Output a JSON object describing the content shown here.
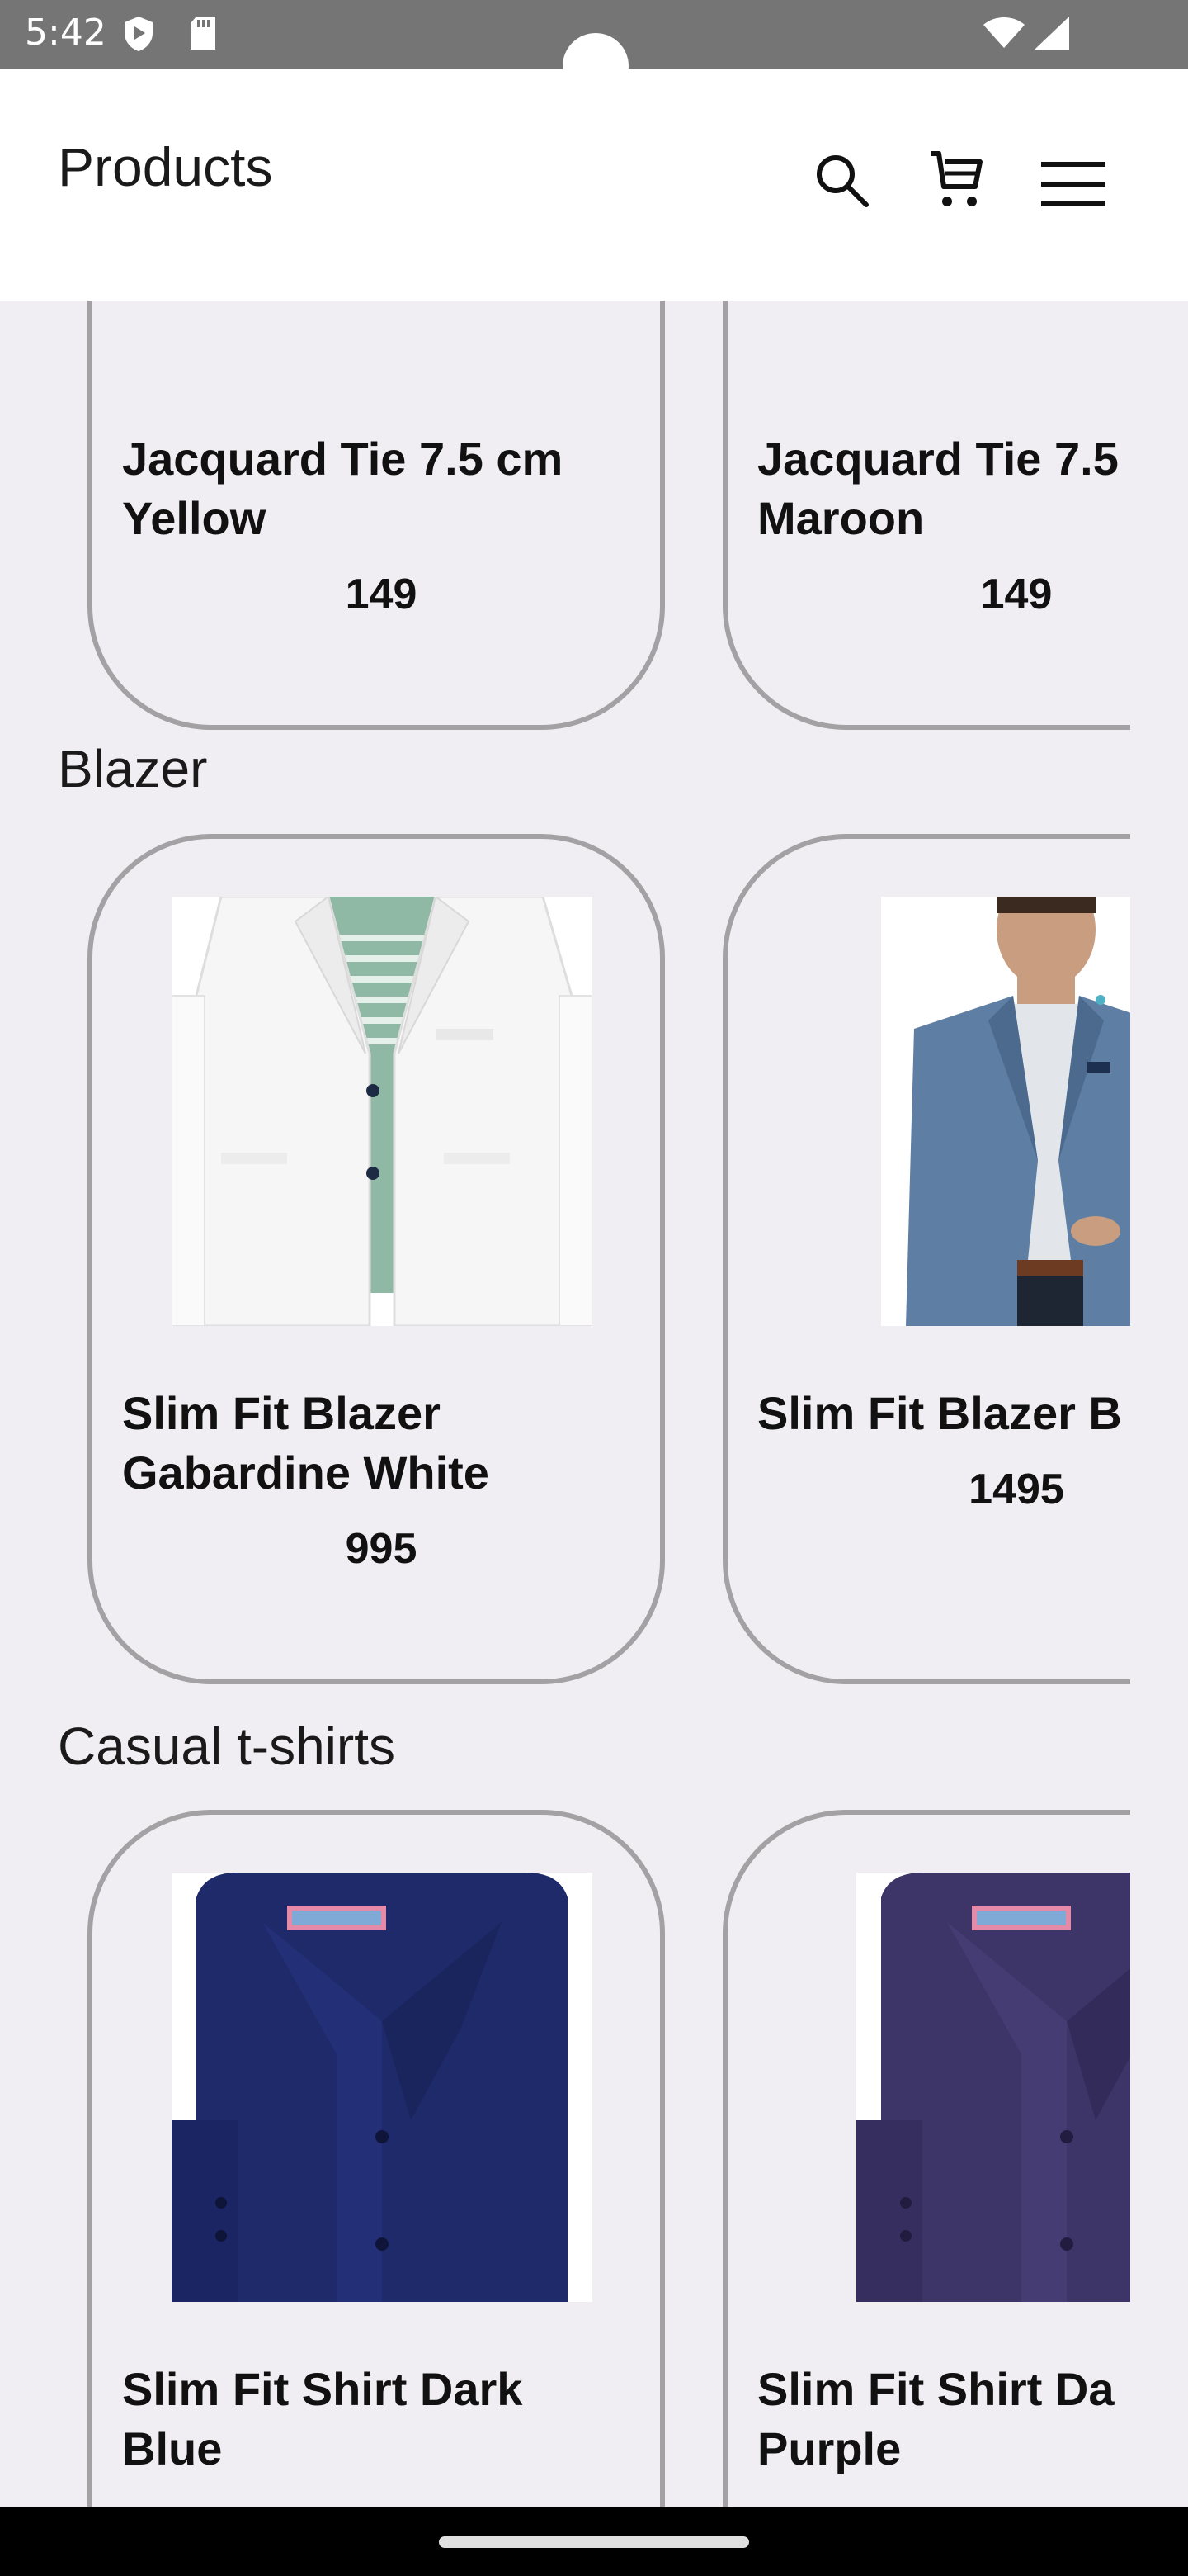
{
  "status_bar": {
    "time": "5:42"
  },
  "app_bar": {
    "title": "Products",
    "icons": [
      "search-icon",
      "cart-icon",
      "menu-icon"
    ]
  },
  "sections": [
    {
      "title": "",
      "cards": [
        {
          "name_line1": "Jacquard Tie 7.5 cm",
          "name_line2": "Yellow",
          "price": "149"
        },
        {
          "name_line1": "Jacquard Tie 7.5",
          "name_line2": "Maroon",
          "price": "149"
        }
      ]
    },
    {
      "title": "Blazer",
      "cards": [
        {
          "name_line1": "Slim Fit Blazer",
          "name_line2": "Gabardine White",
          "price": "995",
          "image": "white-blazer"
        },
        {
          "name_line1": "Slim Fit Blazer B",
          "name_line2": "",
          "price": "1495",
          "image": "blue-blazer"
        }
      ]
    },
    {
      "title": "Casual t-shirts",
      "cards": [
        {
          "name_line1": "Slim Fit Shirt Dark",
          "name_line2": "Blue",
          "image": "dark-blue-shirt"
        },
        {
          "name_line1": "Slim Fit Shirt Da",
          "name_line2": "Purple",
          "image": "dark-purple-shirt"
        }
      ]
    }
  ],
  "colors": {
    "background": "#f0eef2",
    "card_border": "#a3a1a4",
    "status_bar": "#757575",
    "app_bar": "#ffffff"
  }
}
